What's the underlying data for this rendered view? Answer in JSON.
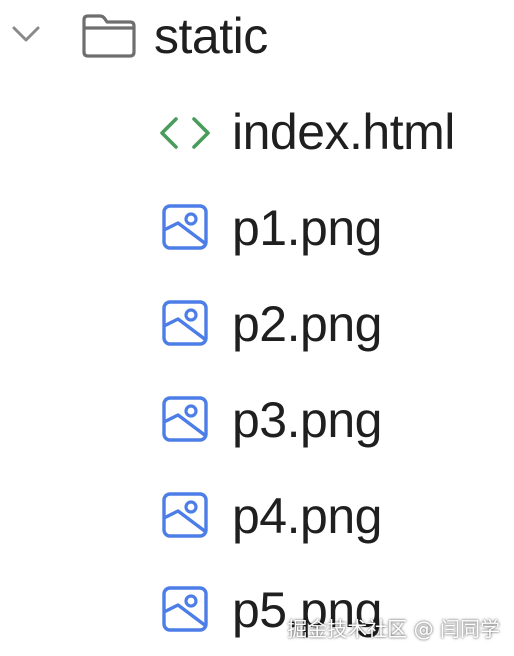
{
  "tree": {
    "folder": {
      "name": "static",
      "expanded": true,
      "icon": "folder-icon",
      "chevron": "chevron-down-icon"
    },
    "files": [
      {
        "name": "index.html",
        "icon": "html-code-icon",
        "icon_color": "#4a9c5d"
      },
      {
        "name": "p1.png",
        "icon": "image-file-icon",
        "icon_color": "#4d7ee8"
      },
      {
        "name": "p2.png",
        "icon": "image-file-icon",
        "icon_color": "#4d7ee8"
      },
      {
        "name": "p3.png",
        "icon": "image-file-icon",
        "icon_color": "#4d7ee8"
      },
      {
        "name": "p4.png",
        "icon": "image-file-icon",
        "icon_color": "#4d7ee8"
      },
      {
        "name": "p5.png",
        "icon": "image-file-icon",
        "icon_color": "#4d7ee8"
      }
    ]
  },
  "watermark": "掘金技术社区 @ 闫同学",
  "colors": {
    "text": "#1f1f1f",
    "chevron": "#8a8a8a",
    "folder_stroke": "#6e6e6e",
    "html_icon": "#4a9c5d",
    "image_icon": "#4d7ee8"
  }
}
